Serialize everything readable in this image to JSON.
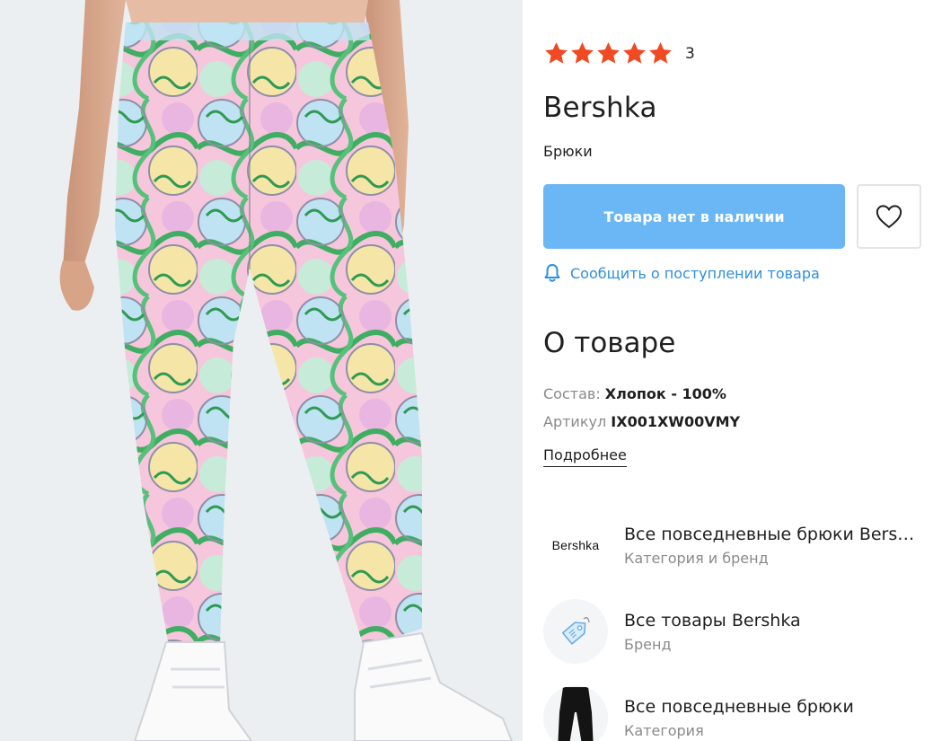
{
  "rating": {
    "stars": 5,
    "count": "3",
    "color": "#f04a23"
  },
  "product": {
    "brand": "Bershka",
    "type": "Брюки"
  },
  "actions": {
    "cart_label": "Товара нет в наличии",
    "favorite_icon": "heart-icon",
    "notify_label": "Сообщить о поступлении товара",
    "notify_icon": "bell-icon",
    "button_color": "#6bb7f5",
    "link_color": "#2e8ee0"
  },
  "about": {
    "title": "О товаре",
    "composition_label": "Состав:",
    "composition_value": "Хлопок - 100%",
    "article_label": "Артикул",
    "article_value": "IX001XW00VMY",
    "more_label": "Подробнее"
  },
  "links": [
    {
      "thumb_text": "Bershka",
      "title": "Все повседневные брюки Bershka",
      "subtitle": "Категория и бренд"
    },
    {
      "thumb_icon": "price-tag-icon",
      "title": "Все товары Bershka",
      "subtitle": "Бренд"
    },
    {
      "thumb_icon": "black-trousers-image",
      "title": "Все повседневные брюки",
      "subtitle": "Категория"
    }
  ]
}
